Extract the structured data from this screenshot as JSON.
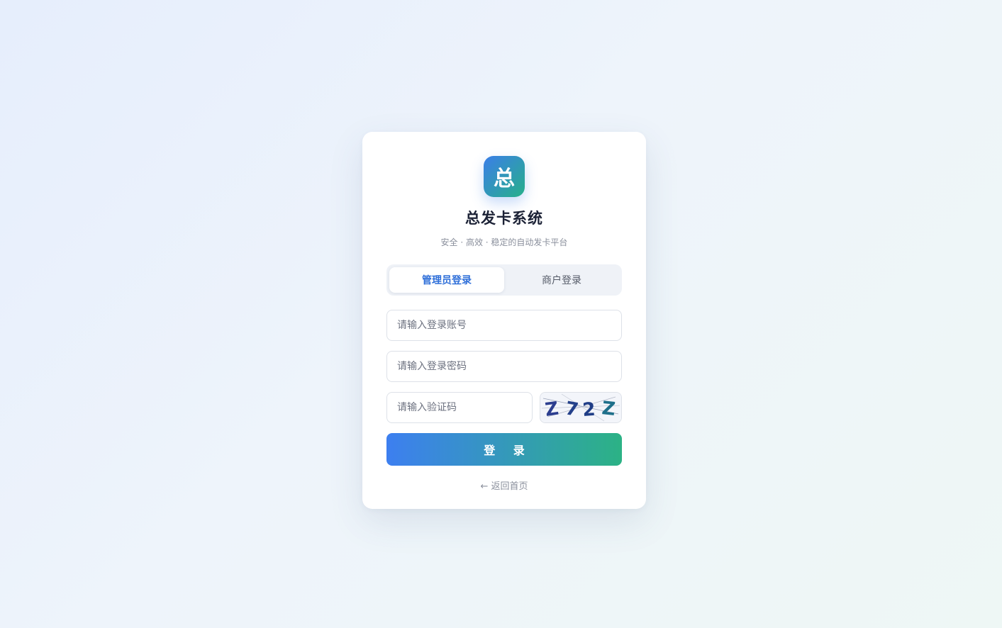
{
  "brand": {
    "logo_char": "总",
    "title": "总发卡系统",
    "subtitle": "安全 · 高效 · 稳定的自动发卡平台"
  },
  "tabs": [
    {
      "label": "管理员登录",
      "active": true
    },
    {
      "label": "商户登录",
      "active": false
    }
  ],
  "form": {
    "account_placeholder": "请输入登录账号",
    "password_placeholder": "请输入登录密码",
    "captcha_placeholder": "请输入验证码",
    "captcha_text": "Z72Z",
    "submit_label": "登 录"
  },
  "back_link": "← 返回首页",
  "colors": {
    "accent_blue": "#3d7ff0",
    "accent_green": "#2cb285",
    "active_tab_text": "#2f6fd9"
  }
}
